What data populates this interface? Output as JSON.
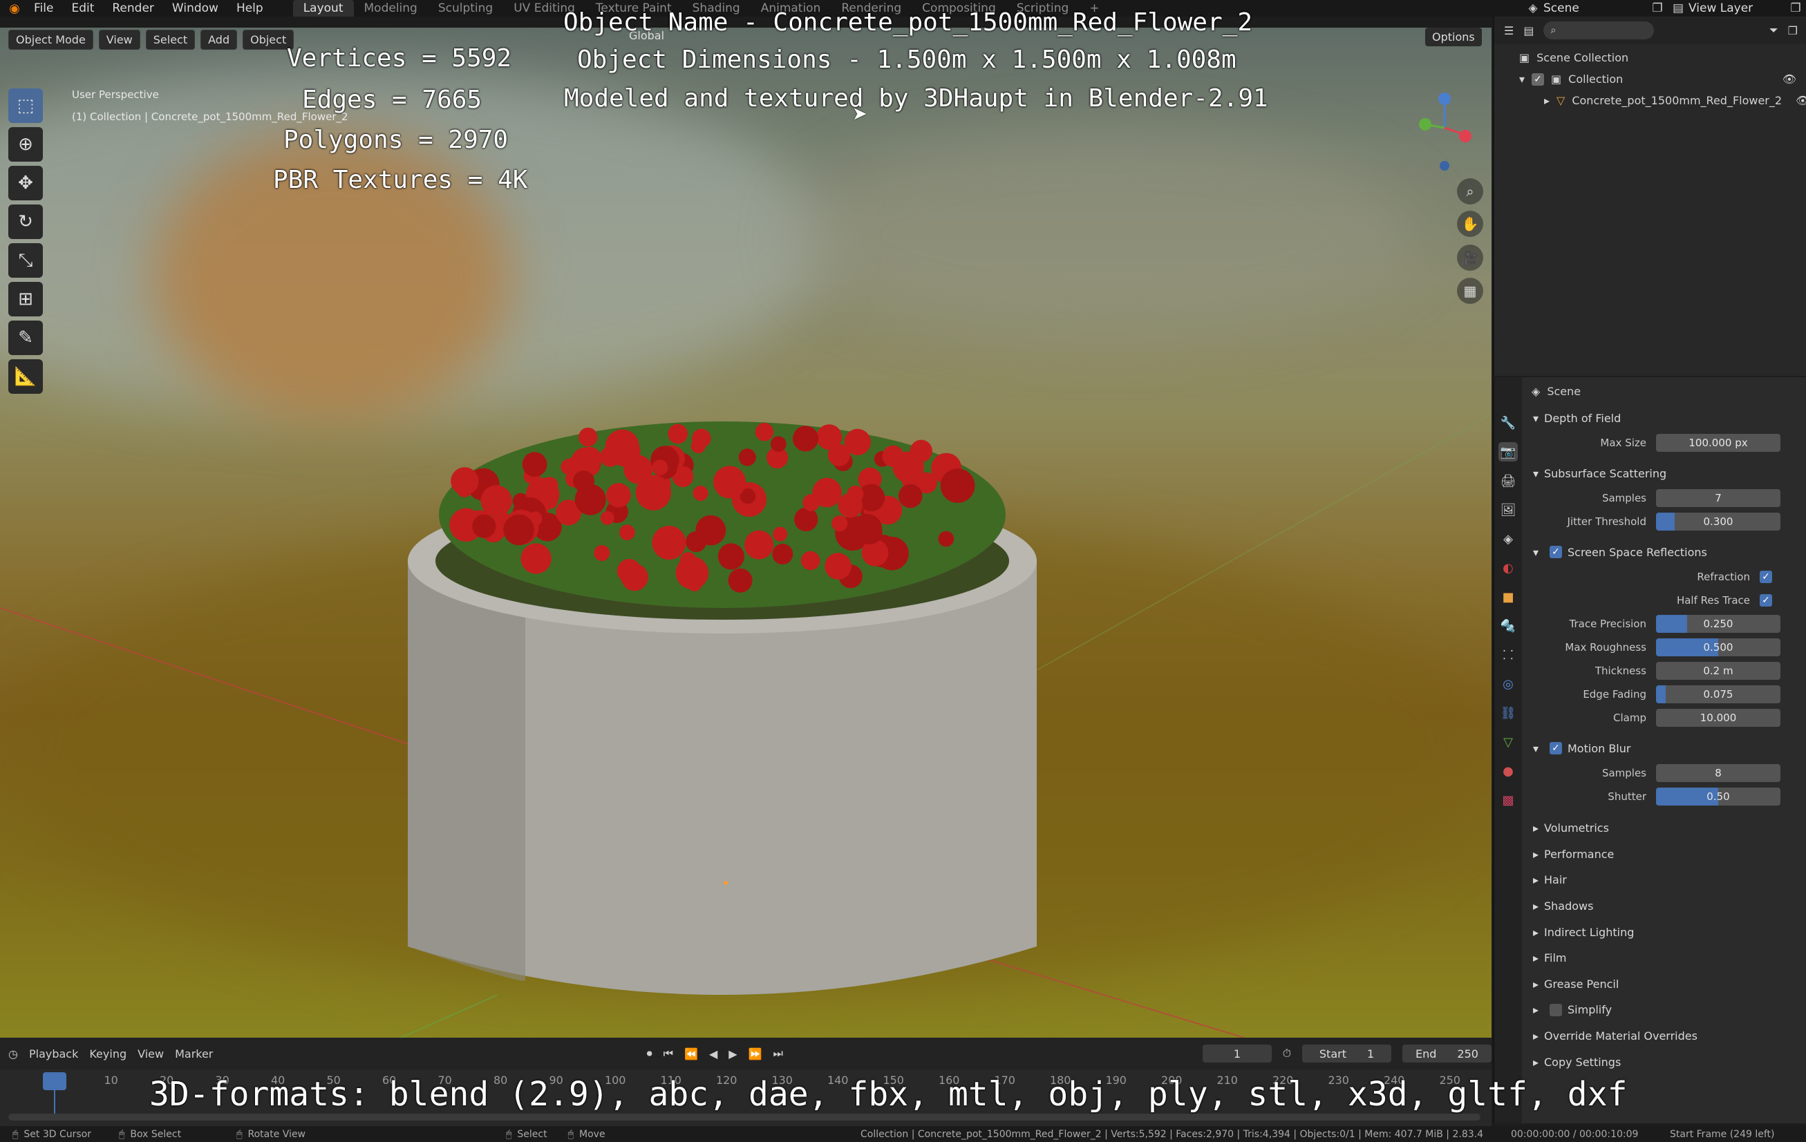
{
  "topbar": {
    "menus": [
      "File",
      "Edit",
      "Render",
      "Window",
      "Help"
    ],
    "workspaces": [
      "Layout",
      "Modeling",
      "Sculpting",
      "UV Editing",
      "Texture Paint",
      "Shading",
      "Animation",
      "Rendering",
      "Compositing",
      "Scripting"
    ],
    "scene": "Scene",
    "view_layer": "View Layer"
  },
  "viewport": {
    "mode": "Object Mode",
    "menus": [
      "View",
      "Select",
      "Add",
      "Object"
    ],
    "orientation": "Global",
    "options": "Options",
    "perspective": "User Perspective",
    "collection_line": "(1) Collection | Concrete_pot_1500mm_Red_Flower_2",
    "overlay": {
      "object_name": "Object Name - Concrete_pot_1500mm_Red_Flower_2",
      "dimensions": "Object Dimensions -  1.500m x 1.500m x 1.008m",
      "credits": "Modeled and textured by 3DHaupt in Blender-2.91",
      "vertices": "Vertices = 5592",
      "edges": "Edges = 7665",
      "polygons": "Polygons = 2970",
      "textures": "PBR Textures = 4K",
      "formats": "3D-formats: blend (2.9), abc, dae, fbx, mtl, obj, ply, stl, x3d, gltf, dxf"
    }
  },
  "outliner": {
    "root": "Scene Collection",
    "collection": "Collection",
    "object": "Concrete_pot_1500mm_Red_Flower_2"
  },
  "properties": {
    "context": "Scene",
    "dof": {
      "title": "Depth of Field",
      "max_size_label": "Max Size",
      "max_size": "100.000 px"
    },
    "sss": {
      "title": "Subsurface Scattering",
      "samples_label": "Samples",
      "samples": "7",
      "jitter_label": "Jitter Threshold",
      "jitter": "0.300",
      "jitter_frac": 0.15
    },
    "ssr": {
      "title": "Screen Space Reflections",
      "refraction_label": "Refraction",
      "half_res_label": "Half Res Trace",
      "trace_precision_label": "Trace Precision",
      "trace_precision": "0.250",
      "trace_precision_frac": 0.25,
      "max_roughness_label": "Max Roughness",
      "max_roughness": "0.500",
      "max_roughness_frac": 0.5,
      "thickness_label": "Thickness",
      "thickness": "0.2 m",
      "edge_fading_label": "Edge Fading",
      "edge_fading": "0.075",
      "edge_fading_frac": 0.075,
      "clamp_label": "Clamp",
      "clamp": "10.000"
    },
    "motion_blur": {
      "title": "Motion Blur",
      "samples_label": "Samples",
      "samples": "8",
      "shutter_label": "Shutter",
      "shutter": "0.50",
      "shutter_frac": 0.5
    },
    "collapsed": [
      "Volumetrics",
      "Performance",
      "Hair",
      "Shadows",
      "Indirect Lighting",
      "Film",
      "Grease Pencil",
      "Simplify",
      "Override Material Overrides",
      "Copy Settings"
    ]
  },
  "timeline": {
    "menus": [
      "Playback",
      "Keying",
      "View",
      "Marker"
    ],
    "current_frame": "1",
    "start_label": "Start",
    "start": "1",
    "end_label": "End",
    "end": "250",
    "ticks": [
      "1",
      "10",
      "20",
      "30",
      "40",
      "50",
      "60",
      "70",
      "80",
      "90",
      "100",
      "110",
      "120",
      "130",
      "140",
      "150",
      "160",
      "170",
      "180",
      "190",
      "200",
      "210",
      "220",
      "230",
      "240",
      "250"
    ]
  },
  "statusbar": {
    "items": [
      "Set 3D Cursor",
      "Box Select",
      "Rotate View",
      "Select",
      "Move"
    ],
    "stats": "Collection | Concrete_pot_1500mm_Red_Flower_2 | Verts:5,592 | Faces:2,970 | Tris:4,394 | Objects:0/1 | Mem: 407.7 MiB | 2.83.4",
    "time": "00:00:00:00 / 00:00:10:09",
    "start_frame": "Start Frame (249 left)"
  }
}
